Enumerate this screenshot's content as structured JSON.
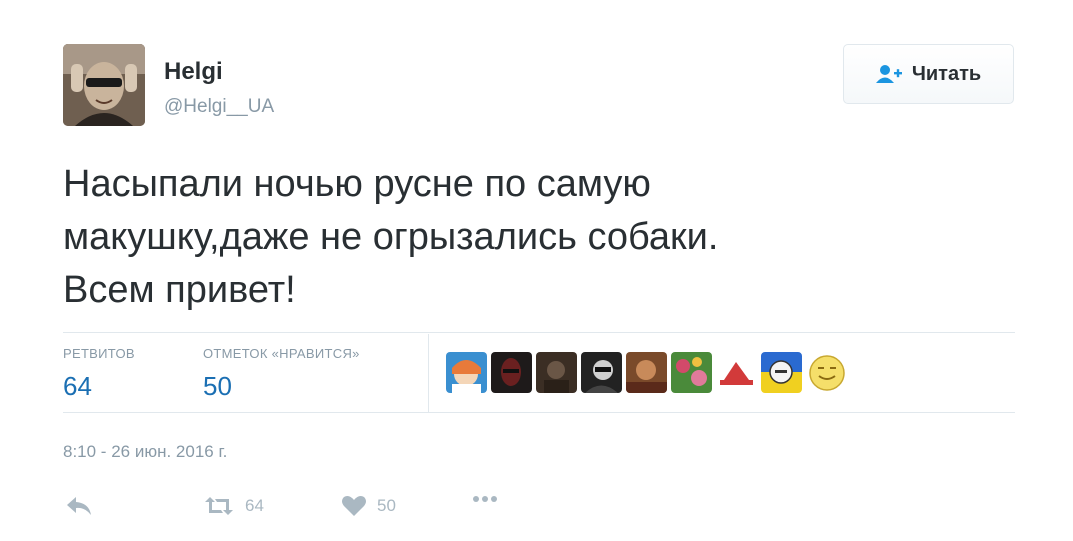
{
  "author": {
    "name": "Helgi",
    "handle": "@Helgi__UA"
  },
  "follow_button": {
    "label": "Читать",
    "icon": "person-add-icon"
  },
  "tweet": {
    "lines": [
      "Насыпали ночью русне по самую",
      "макушку,даже не огрызались собаки.",
      "Всем привет!"
    ]
  },
  "stats": {
    "retweets_label": "РЕТВИТОВ",
    "retweets_count": "64",
    "likes_label": "ОТМЕТОК «НРАВИТСЯ»",
    "likes_count": "50"
  },
  "likers": [
    "avatar-1",
    "avatar-2",
    "avatar-3",
    "avatar-4",
    "avatar-5",
    "avatar-6",
    "avatar-7",
    "avatar-8",
    "avatar-9"
  ],
  "timestamp": "8:10 - 26 июн. 2016 г.",
  "actions": {
    "reply_icon": "reply-icon",
    "retweet_icon": "retweet-icon",
    "retweet_count": "64",
    "like_icon": "heart-icon",
    "like_count": "50",
    "more_icon": "more-icon"
  },
  "colors": {
    "accent": "#1b6fb3",
    "muted": "#8899a6",
    "action_grey": "#aab8c2",
    "text": "#292f33",
    "divider": "#e1e8ed"
  }
}
